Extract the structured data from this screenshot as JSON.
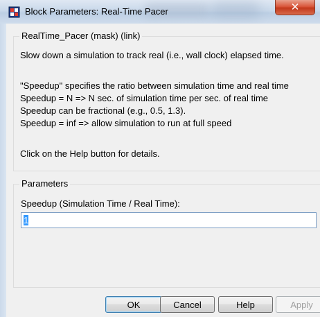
{
  "window": {
    "title": "Block Parameters: Real-Time Pacer"
  },
  "description": {
    "group_title": "RealTime_Pacer (mask) (link)",
    "lines": [
      "Slow down a simulation to track real (i.e., wall clock) elapsed time.",
      "\"Speedup\" specifies the ratio between simulation time and real time",
      " Speedup = N => N sec. of simulation time per sec. of real time",
      " Speedup can be fractional (e.g., 0.5, 1.3).",
      " Speedup = inf => allow simulation to run at full speed",
      "Click on the Help button for details."
    ]
  },
  "parameters": {
    "group_title": "Parameters",
    "speedup_label": "Speedup (Simulation Time / Real Time):",
    "speedup_value": "1"
  },
  "buttons": {
    "ok": "OK",
    "cancel": "Cancel",
    "help": "Help",
    "apply": "Apply"
  },
  "icons": {
    "close": "close-icon",
    "app": "simulink-block-icon"
  }
}
